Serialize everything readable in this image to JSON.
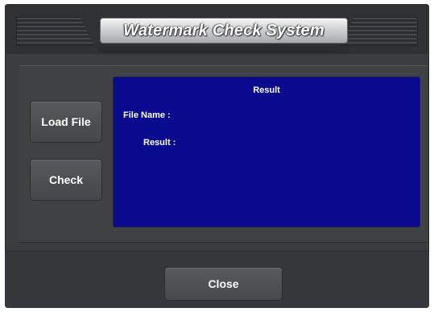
{
  "window": {
    "title": "Watermark Check System"
  },
  "sidebar": {
    "buttons": [
      {
        "label": "Load File"
      },
      {
        "label": "Check"
      }
    ]
  },
  "result_panel": {
    "heading": "Result",
    "file_name_label": "File Name :",
    "result_label": "Result :",
    "background_color": "#0a0a8e"
  },
  "footer": {
    "close_label": "Close"
  }
}
